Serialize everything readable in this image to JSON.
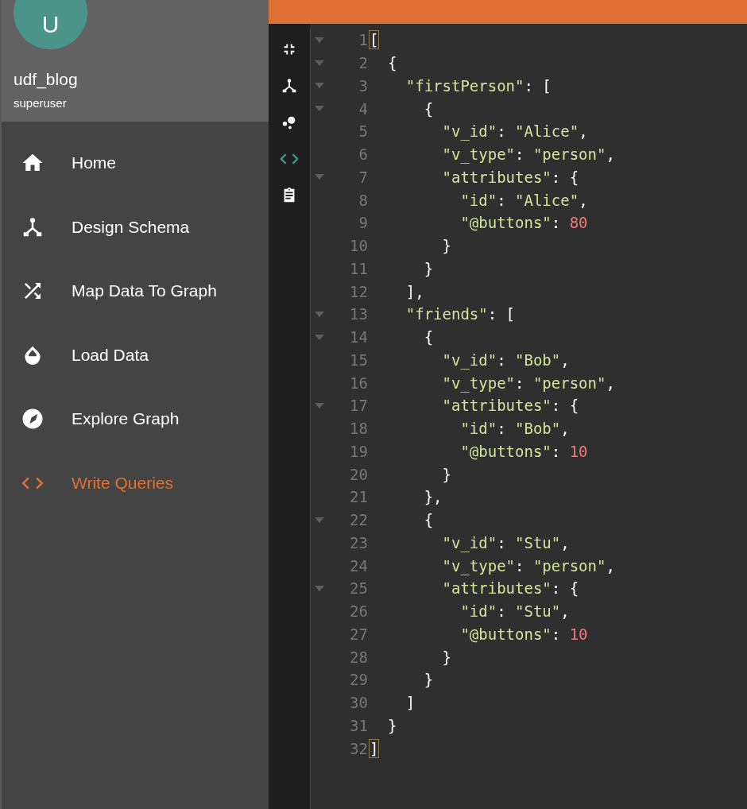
{
  "account": {
    "avatar_letter": "U",
    "name": "udf_blog",
    "role": "superuser"
  },
  "nav": [
    {
      "label": "Home",
      "selected": false
    },
    {
      "label": "Design Schema",
      "selected": false
    },
    {
      "label": "Map Data To Graph",
      "selected": false
    },
    {
      "label": "Load Data",
      "selected": false
    },
    {
      "label": "Explore Graph",
      "selected": false
    },
    {
      "label": "Write Queries",
      "selected": true
    }
  ],
  "toolbar": [
    {
      "selected": false
    },
    {
      "selected": false
    },
    {
      "selected": false
    },
    {
      "selected": true
    },
    {
      "selected": false
    }
  ],
  "editor": {
    "lines": [
      {
        "number": "1",
        "foldable": true,
        "tokens": [
          {
            "kind": "match",
            "text": "["
          }
        ]
      },
      {
        "number": "2",
        "foldable": true,
        "tokens": [
          {
            "kind": "punct",
            "text": "  {"
          }
        ]
      },
      {
        "number": "3",
        "foldable": true,
        "tokens": [
          {
            "kind": "key",
            "text": "    \"firstPerson\""
          },
          {
            "kind": "punct",
            "text": ": ["
          }
        ]
      },
      {
        "number": "4",
        "foldable": true,
        "tokens": [
          {
            "kind": "punct",
            "text": "      {"
          }
        ]
      },
      {
        "number": "5",
        "foldable": false,
        "tokens": [
          {
            "kind": "key",
            "text": "        \"v_id\""
          },
          {
            "kind": "punct",
            "text": ": "
          },
          {
            "kind": "string",
            "text": "\"Alice\""
          },
          {
            "kind": "punct",
            "text": ","
          }
        ]
      },
      {
        "number": "6",
        "foldable": false,
        "tokens": [
          {
            "kind": "key",
            "text": "        \"v_type\""
          },
          {
            "kind": "punct",
            "text": ": "
          },
          {
            "kind": "string",
            "text": "\"person\""
          },
          {
            "kind": "punct",
            "text": ","
          }
        ]
      },
      {
        "number": "7",
        "foldable": true,
        "tokens": [
          {
            "kind": "key",
            "text": "        \"attributes\""
          },
          {
            "kind": "punct",
            "text": ": {"
          }
        ]
      },
      {
        "number": "8",
        "foldable": false,
        "tokens": [
          {
            "kind": "key",
            "text": "          \"id\""
          },
          {
            "kind": "punct",
            "text": ": "
          },
          {
            "kind": "string",
            "text": "\"Alice\""
          },
          {
            "kind": "punct",
            "text": ","
          }
        ]
      },
      {
        "number": "9",
        "foldable": false,
        "tokens": [
          {
            "kind": "key",
            "text": "          \"@buttons\""
          },
          {
            "kind": "punct",
            "text": ": "
          },
          {
            "kind": "number",
            "text": "80"
          }
        ]
      },
      {
        "number": "10",
        "foldable": false,
        "tokens": [
          {
            "kind": "punct",
            "text": "        }"
          }
        ]
      },
      {
        "number": "11",
        "foldable": false,
        "tokens": [
          {
            "kind": "punct",
            "text": "      }"
          }
        ]
      },
      {
        "number": "12",
        "foldable": false,
        "tokens": [
          {
            "kind": "punct",
            "text": "    ],"
          }
        ]
      },
      {
        "number": "13",
        "foldable": true,
        "tokens": [
          {
            "kind": "key",
            "text": "    \"friends\""
          },
          {
            "kind": "punct",
            "text": ": ["
          }
        ]
      },
      {
        "number": "14",
        "foldable": true,
        "tokens": [
          {
            "kind": "punct",
            "text": "      {"
          }
        ]
      },
      {
        "number": "15",
        "foldable": false,
        "tokens": [
          {
            "kind": "key",
            "text": "        \"v_id\""
          },
          {
            "kind": "punct",
            "text": ": "
          },
          {
            "kind": "string",
            "text": "\"Bob\""
          },
          {
            "kind": "punct",
            "text": ","
          }
        ]
      },
      {
        "number": "16",
        "foldable": false,
        "tokens": [
          {
            "kind": "key",
            "text": "        \"v_type\""
          },
          {
            "kind": "punct",
            "text": ": "
          },
          {
            "kind": "string",
            "text": "\"person\""
          },
          {
            "kind": "punct",
            "text": ","
          }
        ]
      },
      {
        "number": "17",
        "foldable": true,
        "tokens": [
          {
            "kind": "key",
            "text": "        \"attributes\""
          },
          {
            "kind": "punct",
            "text": ": {"
          }
        ]
      },
      {
        "number": "18",
        "foldable": false,
        "tokens": [
          {
            "kind": "key",
            "text": "          \"id\""
          },
          {
            "kind": "punct",
            "text": ": "
          },
          {
            "kind": "string",
            "text": "\"Bob\""
          },
          {
            "kind": "punct",
            "text": ","
          }
        ]
      },
      {
        "number": "19",
        "foldable": false,
        "tokens": [
          {
            "kind": "key",
            "text": "          \"@buttons\""
          },
          {
            "kind": "punct",
            "text": ": "
          },
          {
            "kind": "number",
            "text": "10"
          }
        ]
      },
      {
        "number": "20",
        "foldable": false,
        "tokens": [
          {
            "kind": "punct",
            "text": "        }"
          }
        ]
      },
      {
        "number": "21",
        "foldable": false,
        "tokens": [
          {
            "kind": "punct",
            "text": "      },"
          }
        ]
      },
      {
        "number": "22",
        "foldable": true,
        "tokens": [
          {
            "kind": "punct",
            "text": "      {"
          }
        ]
      },
      {
        "number": "23",
        "foldable": false,
        "tokens": [
          {
            "kind": "key",
            "text": "        \"v_id\""
          },
          {
            "kind": "punct",
            "text": ": "
          },
          {
            "kind": "string",
            "text": "\"Stu\""
          },
          {
            "kind": "punct",
            "text": ","
          }
        ]
      },
      {
        "number": "24",
        "foldable": false,
        "tokens": [
          {
            "kind": "key",
            "text": "        \"v_type\""
          },
          {
            "kind": "punct",
            "text": ": "
          },
          {
            "kind": "string",
            "text": "\"person\""
          },
          {
            "kind": "punct",
            "text": ","
          }
        ]
      },
      {
        "number": "25",
        "foldable": true,
        "tokens": [
          {
            "kind": "key",
            "text": "        \"attributes\""
          },
          {
            "kind": "punct",
            "text": ": {"
          }
        ]
      },
      {
        "number": "26",
        "foldable": false,
        "tokens": [
          {
            "kind": "key",
            "text": "          \"id\""
          },
          {
            "kind": "punct",
            "text": ": "
          },
          {
            "kind": "string",
            "text": "\"Stu\""
          },
          {
            "kind": "punct",
            "text": ","
          }
        ]
      },
      {
        "number": "27",
        "foldable": false,
        "tokens": [
          {
            "kind": "key",
            "text": "          \"@buttons\""
          },
          {
            "kind": "punct",
            "text": ": "
          },
          {
            "kind": "number",
            "text": "10"
          }
        ]
      },
      {
        "number": "28",
        "foldable": false,
        "tokens": [
          {
            "kind": "punct",
            "text": "        }"
          }
        ]
      },
      {
        "number": "29",
        "foldable": false,
        "tokens": [
          {
            "kind": "punct",
            "text": "      }"
          }
        ]
      },
      {
        "number": "30",
        "foldable": false,
        "tokens": [
          {
            "kind": "punct",
            "text": "    ]"
          }
        ]
      },
      {
        "number": "31",
        "foldable": false,
        "tokens": [
          {
            "kind": "punct",
            "text": "  }"
          }
        ]
      },
      {
        "number": "32",
        "foldable": false,
        "tokens": [
          {
            "kind": "match",
            "text": "]"
          }
        ]
      }
    ]
  }
}
